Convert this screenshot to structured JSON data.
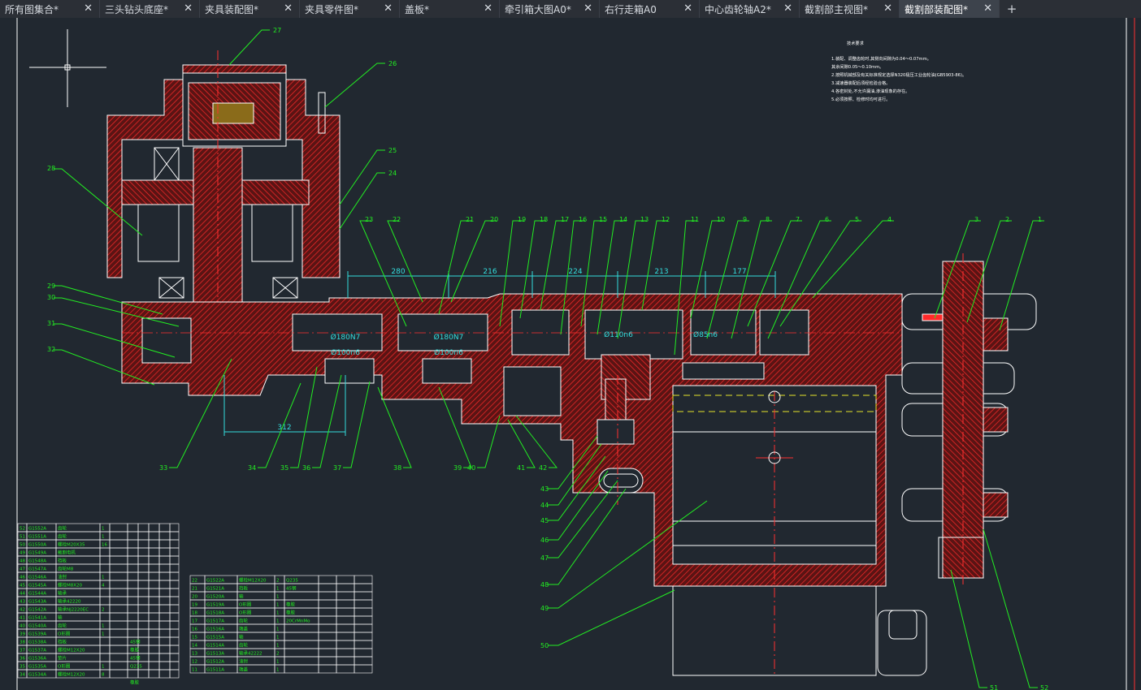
{
  "tabs": [
    {
      "label": "所有图集合*",
      "active": false
    },
    {
      "label": "三头钻头底座*",
      "active": false
    },
    {
      "label": "夹具装配图*",
      "active": false
    },
    {
      "label": "夹具零件图*",
      "active": false
    },
    {
      "label": "盖板*",
      "active": false
    },
    {
      "label": "牵引箱大图A0*",
      "active": false
    },
    {
      "label": "右行走箱A0",
      "active": false
    },
    {
      "label": "中心齿轮轴A2*",
      "active": false
    },
    {
      "label": "截割部主视图*",
      "active": false
    },
    {
      "label": "截割部装配图*",
      "active": true
    }
  ],
  "tab_close_glyph": "✕",
  "tab_add_glyph": "+",
  "colors": {
    "background": "#212830",
    "tabbar": "#2b2f36",
    "tab_active": "#3d434c",
    "geometry": "#ffffff",
    "hatch": "#ff2a2a",
    "leader": "#22ee22",
    "dimension": "#33dddd",
    "hidden_line": "#e5e52a",
    "border_red": "#ff3030"
  },
  "dimensions": [
    "280",
    "216",
    "224",
    "213",
    "177",
    "312"
  ],
  "fits": [
    "Ø180N7",
    "Ø100n6",
    "Ø180N7",
    "Ø100n6",
    "Ø110n6",
    "Ø85n6"
  ],
  "balloons_top": [
    "27",
    "26",
    "25",
    "24",
    "23",
    "22",
    "21",
    "20",
    "19",
    "18",
    "17",
    "16",
    "15",
    "14",
    "13",
    "12",
    "11",
    "10",
    "9",
    "8",
    "7",
    "6",
    "5",
    "4",
    "3",
    "2",
    "1"
  ],
  "balloons_left": [
    "28",
    "29",
    "30",
    "31",
    "32"
  ],
  "balloons_bottom": [
    "33",
    "34",
    "35",
    "36",
    "37",
    "38",
    "39",
    "40",
    "41",
    "42"
  ],
  "balloons_side": [
    "43",
    "44",
    "45",
    "46",
    "47",
    "48",
    "49",
    "50"
  ],
  "balloons_right_bottom": [
    "51",
    "52"
  ],
  "tech_title": "技术要求",
  "tech_lines": [
    "1.装配、调整齿轮时,其侧向间隙为0.04～0.07mm。",
    "  其余间隙0.05～0.10mm。",
    "2.按照机械部及有关标准规定选择N320极压工业齿轮油(GB5903-86)。",
    "3.减速器装配后须经检验合格。",
    "4.各密封处,不允许漏油,渗油现象的存在。",
    "5.必须按照、检修时均可进行。"
  ],
  "bom_left": [
    [
      "52",
      "G1552A",
      "齿轮",
      "1"
    ],
    [
      "51",
      "G1551A",
      "齿轮",
      "1"
    ],
    [
      "50",
      "G1550A",
      "螺栓M20X35",
      "16"
    ],
    [
      "49",
      "G1549A",
      "截割电机",
      ""
    ],
    [
      "48",
      "G1548A",
      "挡板",
      ""
    ],
    [
      "47",
      "G1547A",
      "齿轮M8",
      ""
    ],
    [
      "46",
      "G1546A",
      "油封",
      "1"
    ],
    [
      "45",
      "G1545A",
      "螺栓M8X20",
      "4"
    ],
    [
      "44",
      "G1544A",
      "轴承",
      ""
    ],
    [
      "43",
      "G1543A",
      "轴承42220",
      ""
    ],
    [
      "42",
      "G1542A",
      "轴承NJ2220EC",
      "2"
    ],
    [
      "41",
      "G1541A",
      "轴",
      ""
    ],
    [
      "40",
      "G1540A",
      "齿轮",
      "1"
    ],
    [
      "39",
      "G1539A",
      "O形圈",
      "1"
    ],
    [
      "38",
      "G1538A",
      "挡板",
      ""
    ],
    [
      "37",
      "G1537A",
      "螺栓M12X20",
      ""
    ],
    [
      "36",
      "G1536A",
      "垫片",
      ""
    ],
    [
      "35",
      "G1535A",
      "O形圈",
      "1"
    ],
    [
      "34",
      "G1534A",
      "螺栓M12X20",
      "8"
    ]
  ],
  "bom_left_materials": [
    "",
    "",
    "",
    "",
    "",
    "",
    "",
    "",
    "",
    "",
    "",
    "",
    "",
    "",
    "45钢",
    "橡胶",
    "45钢",
    "Q235",
    "",
    "橡胶",
    ""
  ],
  "bom_right": [
    [
      "22",
      "G1522A",
      "螺栓M12X20",
      "2",
      "Q235"
    ],
    [
      "21",
      "G1521A",
      "挡板",
      "1",
      "45钢"
    ],
    [
      "20",
      "G1520A",
      "轴",
      "1",
      ""
    ],
    [
      "19",
      "G1519A",
      "O形圈",
      "1",
      "橡胶"
    ],
    [
      "18",
      "G1518A",
      "O形圈",
      "1",
      "橡胶"
    ],
    [
      "17",
      "G1517A",
      "齿轮",
      "1",
      "20CrMnMo"
    ],
    [
      "16",
      "G1516A",
      "端盖",
      "1",
      ""
    ],
    [
      "15",
      "G1515A",
      "轴",
      "1",
      ""
    ],
    [
      "14",
      "G1514A",
      "齿轮",
      "1",
      ""
    ],
    [
      "13",
      "G1513A",
      "轴承42222",
      "2",
      ""
    ],
    [
      "12",
      "G1512A",
      "油封",
      "1",
      ""
    ],
    [
      "11",
      "G1511A",
      "端盖",
      "1",
      ""
    ]
  ]
}
